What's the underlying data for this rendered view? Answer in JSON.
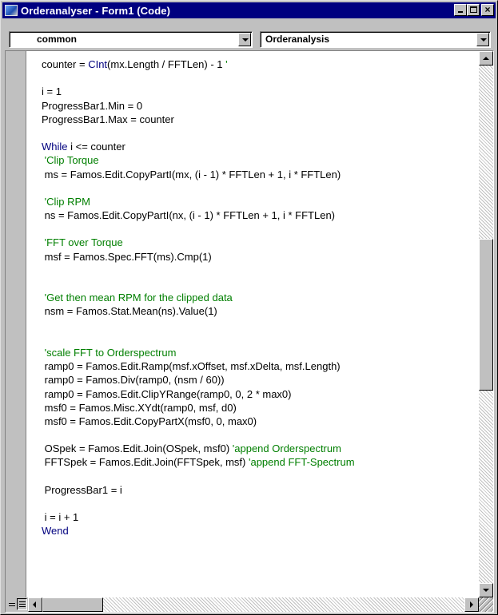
{
  "window": {
    "title": "Orderanalyser - Form1 (Code)"
  },
  "combos": {
    "object": "common",
    "procedure": "Orderanalysis"
  },
  "code": {
    "lines": [
      {
        "parts": [
          {
            "t": "counter = ",
            "c": ""
          },
          {
            "t": "CInt",
            "c": "kw"
          },
          {
            "t": "(mx.Length / FFTLen) - 1 ",
            "c": ""
          },
          {
            "t": "'",
            "c": "cm"
          }
        ]
      },
      {
        "parts": []
      },
      {
        "parts": [
          {
            "t": "i = 1",
            "c": ""
          }
        ]
      },
      {
        "parts": [
          {
            "t": "ProgressBar1.Min = 0",
            "c": ""
          }
        ]
      },
      {
        "parts": [
          {
            "t": "ProgressBar1.Max = counter",
            "c": ""
          }
        ]
      },
      {
        "parts": []
      },
      {
        "parts": [
          {
            "t": "While",
            "c": "kw"
          },
          {
            "t": " i <= counter",
            "c": ""
          }
        ]
      },
      {
        "parts": [
          {
            "t": " 'Clip Torque",
            "c": "cm"
          }
        ]
      },
      {
        "parts": [
          {
            "t": " ms = Famos.Edit.CopyPartI(mx, (i - 1) * FFTLen + 1, i * FFTLen)",
            "c": ""
          }
        ]
      },
      {
        "parts": []
      },
      {
        "parts": [
          {
            "t": " 'Clip RPM",
            "c": "cm"
          }
        ]
      },
      {
        "parts": [
          {
            "t": " ns = Famos.Edit.CopyPartI(nx, (i - 1) * FFTLen + 1, i * FFTLen)",
            "c": ""
          }
        ]
      },
      {
        "parts": []
      },
      {
        "parts": [
          {
            "t": " 'FFT over Torque",
            "c": "cm"
          }
        ]
      },
      {
        "parts": [
          {
            "t": " msf = Famos.Spec.FFT(ms).Cmp(1)",
            "c": ""
          }
        ]
      },
      {
        "parts": []
      },
      {
        "parts": []
      },
      {
        "parts": [
          {
            "t": " 'Get then mean RPM for the clipped data",
            "c": "cm"
          }
        ]
      },
      {
        "parts": [
          {
            "t": " nsm = Famos.Stat.Mean(ns).Value(1)",
            "c": ""
          }
        ]
      },
      {
        "parts": []
      },
      {
        "parts": []
      },
      {
        "parts": [
          {
            "t": " 'scale FFT to Orderspectrum",
            "c": "cm"
          }
        ]
      },
      {
        "parts": [
          {
            "t": " ramp0 = Famos.Edit.Ramp(msf.xOffset, msf.xDelta, msf.Length)",
            "c": ""
          }
        ]
      },
      {
        "parts": [
          {
            "t": " ramp0 = Famos.Div(ramp0, (nsm / 60))",
            "c": ""
          }
        ]
      },
      {
        "parts": [
          {
            "t": " ramp0 = Famos.Edit.ClipYRange(ramp0, 0, 2 * max0)",
            "c": ""
          }
        ]
      },
      {
        "parts": [
          {
            "t": " msf0 = Famos.Misc.XYdt(ramp0, msf, d0)",
            "c": ""
          }
        ]
      },
      {
        "parts": [
          {
            "t": " msf0 = Famos.Edit.CopyPartX(msf0, 0, max0)",
            "c": ""
          }
        ]
      },
      {
        "parts": []
      },
      {
        "parts": [
          {
            "t": " OSpek = Famos.Edit.Join(OSpek, msf0) ",
            "c": ""
          },
          {
            "t": "'append Orderspectrum",
            "c": "cm"
          }
        ]
      },
      {
        "parts": [
          {
            "t": " FFTSpek = Famos.Edit.Join(FFTSpek, msf) ",
            "c": ""
          },
          {
            "t": "'append FFT-Spectrum",
            "c": "cm"
          }
        ]
      },
      {
        "parts": []
      },
      {
        "parts": [
          {
            "t": " ProgressBar1 = i",
            "c": ""
          }
        ]
      },
      {
        "parts": []
      },
      {
        "parts": [
          {
            "t": " i = i + 1",
            "c": ""
          }
        ]
      },
      {
        "parts": [
          {
            "t": "Wend",
            "c": "kw"
          }
        ]
      }
    ]
  },
  "colors": {
    "title_bar": "#000080",
    "keyword": "#00007f",
    "comment": "#007f00",
    "chrome": "#c0c0c0"
  },
  "icons": {
    "app": "vb-form-icon",
    "minimize": "minimize-icon",
    "maximize": "maximize-icon",
    "close": "close-icon"
  }
}
